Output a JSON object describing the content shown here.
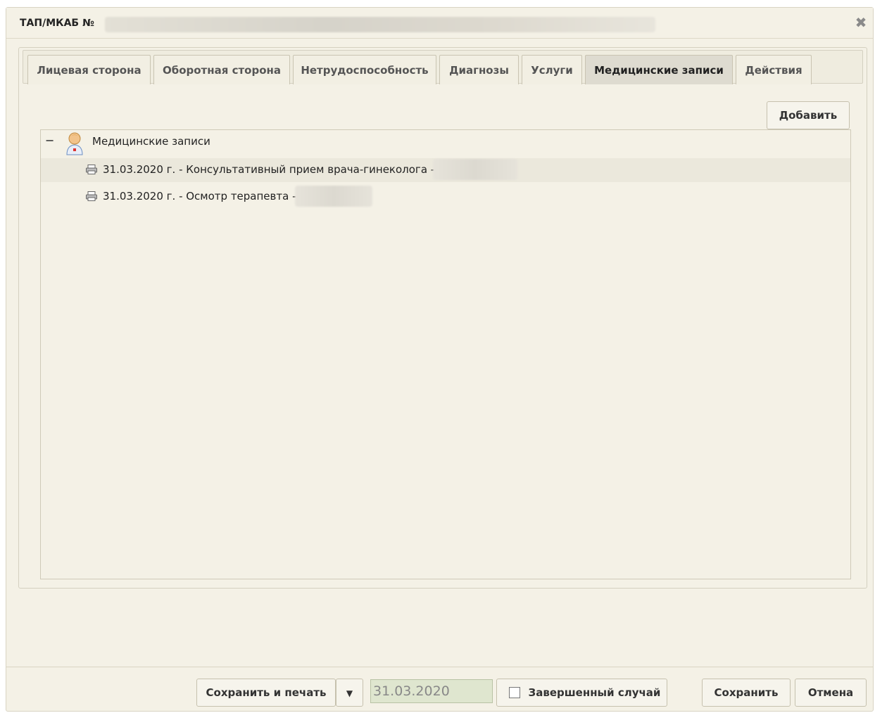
{
  "window": {
    "title": "ТАП/МКАБ №"
  },
  "tabs": [
    {
      "label": "Лицевая сторона",
      "active": false
    },
    {
      "label": "Оборотная сторона",
      "active": false
    },
    {
      "label": "Нетрудоспособность",
      "active": false
    },
    {
      "label": "Диагнозы",
      "active": false
    },
    {
      "label": "Услуги",
      "active": false
    },
    {
      "label": "Медицинские записи",
      "active": true
    },
    {
      "label": "Действия",
      "active": false
    }
  ],
  "toolbar": {
    "add_label": "Добавить"
  },
  "tree": {
    "root_label": "Медицинские записи",
    "items": [
      {
        "label": "31.03.2020 г. - Консультативный прием врача-гинеколога -"
      },
      {
        "label": "31.03.2020 г. - Осмотр терапевта -"
      }
    ]
  },
  "footer": {
    "save_print_label": "Сохранить и печать",
    "date_value": "31.03.2020",
    "completed_label": "Завершенный случай",
    "save_label": "Сохранить",
    "cancel_label": "Отмена"
  },
  "icons": {
    "close": "close-icon",
    "collapse": "collapse-icon",
    "root": "doctor-icon",
    "item": "print-icon",
    "dropdown": "caret-down-icon"
  },
  "colors": {
    "window_bg": "#f4f1e6",
    "active_tab_bg": "#dedbd0",
    "date_field_bg": "#dfe6cf"
  }
}
